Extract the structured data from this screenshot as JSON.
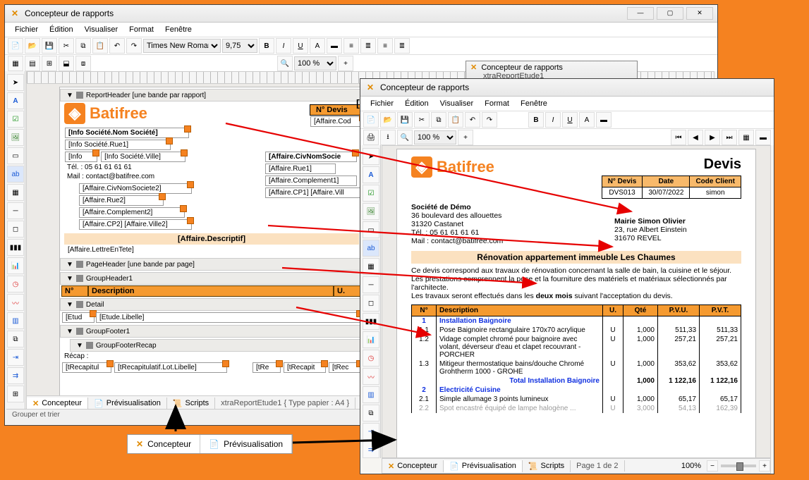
{
  "designer": {
    "title": "Concepteur de rapports",
    "menus": [
      "Fichier",
      "Édition",
      "Visualiser",
      "Format",
      "Fenêtre"
    ],
    "font_name": "Times New Roman",
    "font_size": "9,75",
    "zoom": "100 %",
    "bands": {
      "report_header": "ReportHeader [une bande par rapport]",
      "page_header": "PageHeader [une bande par page]",
      "group_header": "GroupHeader1",
      "detail": "Detail",
      "group_footer": "GroupFooter1",
      "group_footer_recap": "GroupFooterRecap"
    },
    "fields": {
      "societe": "[Info Société.Nom Société]",
      "rue1": "[Info Société.Rue1]",
      "ville": "[Info Société.Ville]",
      "info_prefix": "[Info",
      "tel": "Tél. : 05 61 61 61 61",
      "mail": "Mail : contact@batifree.com",
      "civ2": "[Affaire.CivNomSociete2]",
      "rue2": "[Affaire.Rue2]",
      "compl2": "[Affaire.Complement2]",
      "cp2": "[Affaire.CP2] [Affaire.Ville2]",
      "ndevis_label": "N° Devis",
      "aff_cod": "[Affaire.Cod",
      "civ_nom": "[Affaire.CivNomSocie",
      "aff_rue1": "[Affaire.Rue1]",
      "aff_compl1": "[Affaire.Complement1]",
      "aff_cp1": "[Affaire.CP1] [Affaire.Vill",
      "descriptif": "[Affaire.Descriptif]",
      "lettre": "[Affaire.LettreEnTete]",
      "col_no": "N°",
      "col_desc": "Description",
      "col_u": "U.",
      "detail_etud": "[Etud",
      "detail_lib": "[Etude.Libelle]",
      "recap_label": "Récap :",
      "recap_code": "[tRecapitul",
      "recap_lib": "[tRecapitulatif.Lot.Libelle]",
      "recap_tre": "[tRe",
      "recap_trecap": "[tRecapit",
      "recap_trec": "[tRec",
      "partial_af": "[Af"
    },
    "tabs": {
      "design": "Concepteur",
      "preview": "Prévisualisation",
      "scripts": "Scripts",
      "doc_info": "xtraReportEtude1 { Type papier : A4 }",
      "doc_name": "xtraReportEtude1"
    },
    "status": "Grouper et trier"
  },
  "preview": {
    "title": "Concepteur de rapports",
    "menus": [
      "Fichier",
      "Édition",
      "Visualiser",
      "Format",
      "Fenêtre"
    ],
    "zoom": "100 %",
    "devis_title": "Devis",
    "hdr": {
      "col_ndevis": "N° Devis",
      "col_date": "Date",
      "col_client": "Code Client",
      "ndevis": "DVS013",
      "date": "30/07/2022",
      "client": "simon"
    },
    "societe": {
      "name": "Société de Démo",
      "addr": "36 boulevard des allouettes",
      "ville": "31320 Castanet",
      "tel": "Tél. : 05 61 61 61 61",
      "mail": "Mail : contact@batifree.com"
    },
    "dest": {
      "name": "Mairie Simon Olivier",
      "addr": "23, rue Albert Einstein",
      "ville": "31670 REVEL"
    },
    "section": "Rénovation appartement immeuble Les Chaumes",
    "intro1": "Ce devis correspond aux travaux de rénovation concernant la salle de bain, la cuisine et le séjour.",
    "intro2": "Les prestations comprennent la pose et la fourniture des matériels et matériaux sélectionnés par l'architecte.",
    "intro3_a": "Les travaux seront effectués dans les ",
    "intro3_b": "deux mois",
    "intro3_c": " suivant l'acceptation du devis.",
    "cols": {
      "no": "N°",
      "desc": "Description",
      "u": "U.",
      "qte": "Qté",
      "pvu": "P.V.U.",
      "pvt": "P.V.T."
    },
    "lines": [
      {
        "no": "1",
        "desc": "Installation Baignoire",
        "chap": true
      },
      {
        "no": "1.1",
        "desc": "Pose Baignoire rectangulaire 170x70 acrylique",
        "u": "U",
        "qte": "1,000",
        "pvu": "511,33",
        "pvt": "511,33"
      },
      {
        "no": "1.2",
        "desc": "Vidage complet chromé pour baignoire avec volant, déverseur d'eau et clapet recouvrant - PORCHER",
        "u": "U",
        "qte": "1,000",
        "pvu": "257,21",
        "pvt": "257,21"
      },
      {
        "no": "1.3",
        "desc": "Mitigeur thermostatique bains/douche Chromé Grohtherm 1000 - GROHE",
        "u": "U",
        "qte": "1,000",
        "pvu": "353,62",
        "pvt": "353,62"
      },
      {
        "total": true,
        "label": "Total Installation Baignoire",
        "qte": "1,000",
        "pvu": "1 122,16",
        "pvt": "1 122,16"
      },
      {
        "no": "2",
        "desc": "Electricité Cuisine",
        "chap": true
      },
      {
        "no": "2.1",
        "desc": "Simple allumage 3 points lumineux",
        "u": "U",
        "qte": "1,000",
        "pvu": "65,17",
        "pvt": "65,17"
      },
      {
        "no": "2.2",
        "desc": "Spot encastré équipé de lampe halogène ...",
        "u": "U",
        "qte": "3,000",
        "pvu": "54,13",
        "pvt": "162,39",
        "cut": true
      }
    ],
    "tabs": {
      "design": "Concepteur",
      "preview": "Prévisualisation",
      "scripts": "Scripts",
      "page": "Page 1 de 2"
    },
    "zoom_status": "100%"
  },
  "pair": {
    "design": "Concepteur",
    "preview": "Prévisualisation"
  }
}
